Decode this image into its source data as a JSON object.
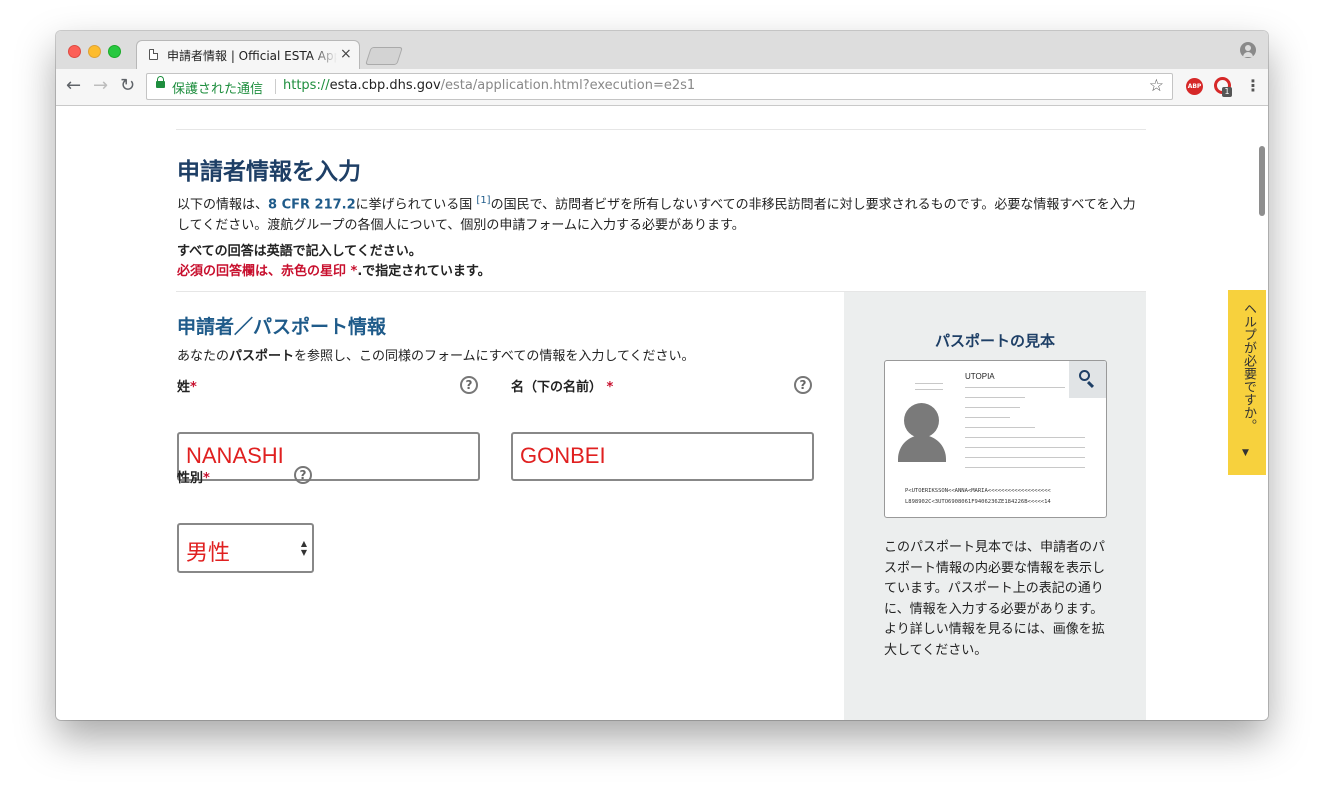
{
  "browser": {
    "tab_title": "申請者情報 | Official ESTA Application",
    "tab_close": "×",
    "secure_label": "保護された通信",
    "url_scheme": "https://",
    "url_host": "esta.cbp.dhs.gov",
    "url_path": "/esta/application.html?execution=e2s1",
    "abp_label": "ABP",
    "ext_badge": "1"
  },
  "page": {
    "title": "申請者情報を入力",
    "intro_before": "以下の情報は、",
    "intro_cfr": "8 CFR 217.2",
    "intro_mid": "に挙げられている国 ",
    "intro_sup": "[1]",
    "intro_after": "の国民で、訪問者ビザを所有しないすべての非移民訪問者に対し要求されるものです。必要な情報すべてを入力してください。渡航グループの各個人について、個別の申請フォームに入力する必要があります。",
    "note_english": "すべての回答は英語で記入してください。",
    "note_required": "必須の回答欄は、赤色の星印 *",
    "note_required_suffix": ".で指定されています。"
  },
  "form": {
    "section_title": "申請者／パスポート情報",
    "section_desc_before": "あなたの",
    "section_desc_bold": "パスポート",
    "section_desc_after": "を参照し、この同様のフォームにすべての情報を入力してください。",
    "required_mark": "*",
    "surname_label": "姓",
    "surname_value": "NANASHI",
    "given_label": "名（下の名前）",
    "given_value": "GONBEI",
    "gender_label": "性別",
    "gender_value": "男性",
    "help_glyph": "?"
  },
  "sample": {
    "title": "パスポートの見本",
    "pp_country": "UTOPIA",
    "pp_mrz1": "P<UTOERIKSSON<<ANNA<MARIA<<<<<<<<<<<<<<<<<<<",
    "pp_mrz2": "L898902C<3UTO6908061F9406236ZE184226B<<<<<14",
    "description": "このパスポート見本では、申請者のパスポート情報の内必要な情報を表示しています。パスポート上の表記の通りに、情報を入力する必要があります。より詳しい情報を見るには、画像を拡大してください。"
  },
  "help_tab": {
    "label": "ヘルプが必要ですか。",
    "arrow": "▼"
  },
  "colors": {
    "title_navy": "#1e3f66",
    "section_blue": "#1f5b8a",
    "required_red": "#c8102e",
    "input_red": "#e02020",
    "help_yellow": "#f7d13d",
    "panel_grey": "#eceeee"
  }
}
